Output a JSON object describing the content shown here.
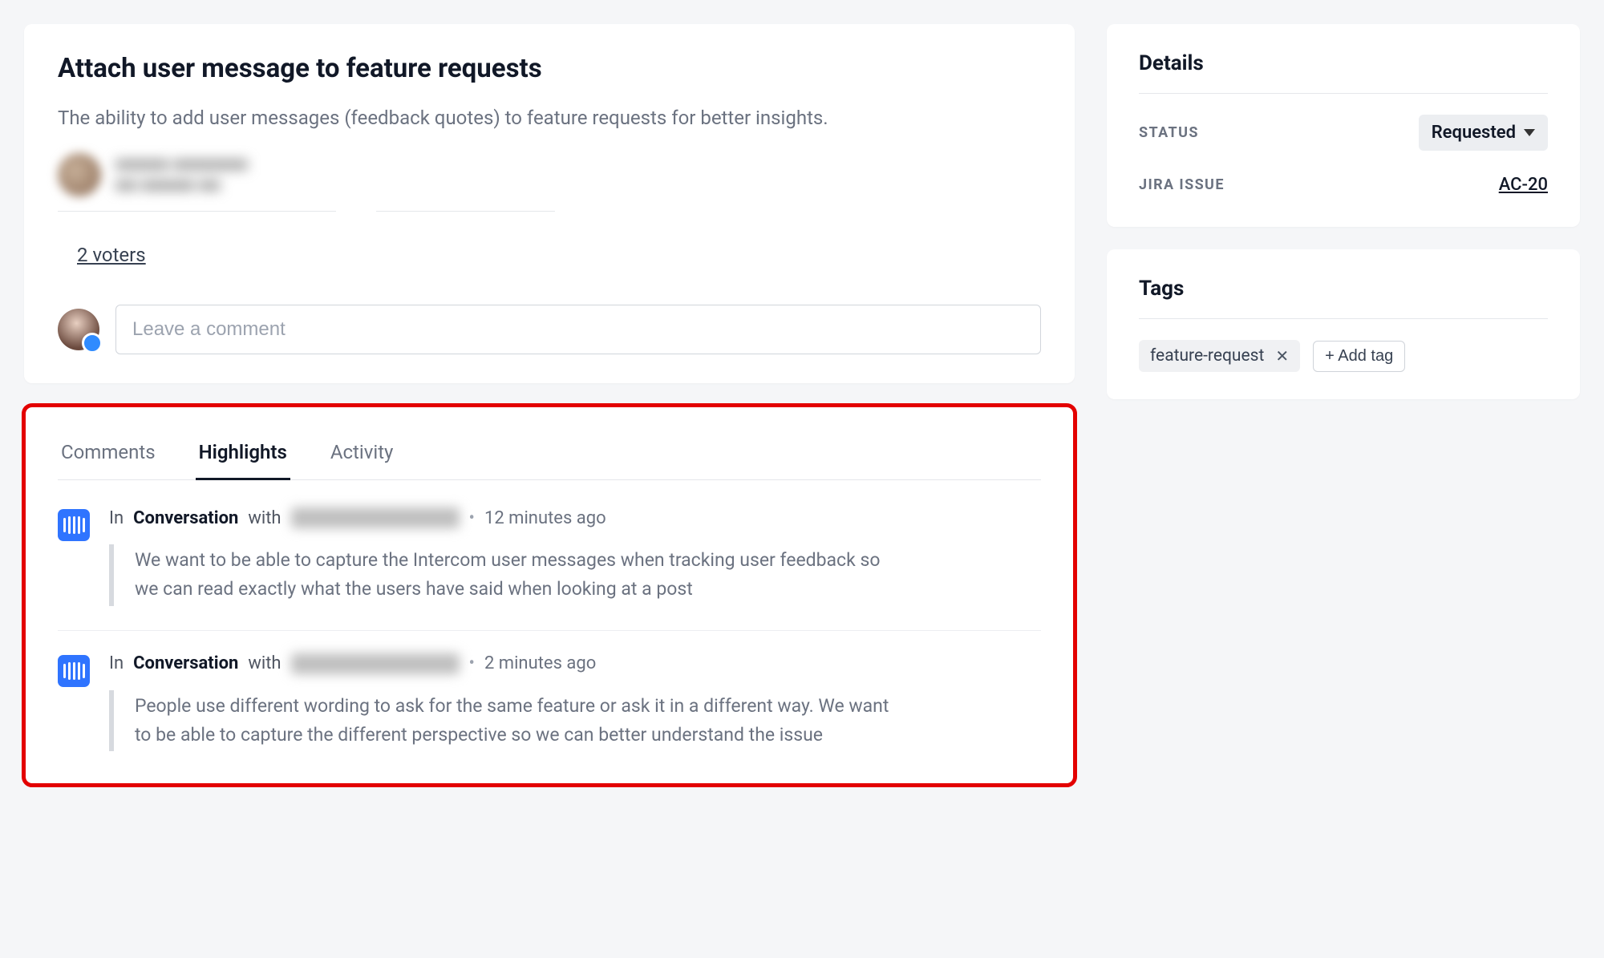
{
  "post": {
    "title": "Attach user message   to feature requests",
    "description": "The ability to add user messages (feedback quotes) to feature requests for better insights.",
    "voters_label": "2 voters",
    "comment_placeholder": "Leave a comment"
  },
  "tabs": {
    "comments": "Comments",
    "highlights": "Highlights",
    "activity": "Activity"
  },
  "highlights": [
    {
      "prefix": "In",
      "strong": "Conversation",
      "with": "with",
      "time": "12 minutes ago",
      "quote": "We want to be able to capture the Intercom user messages when tracking user feedback so we can read exactly what the users have said when looking at a post"
    },
    {
      "prefix": "In",
      "strong": "Conversation",
      "with": "with",
      "time": "2 minutes ago",
      "quote": "People use different wording to ask for the same feature or ask it in a different way. We want to be able to capture the different perspective so we can better understand the issue"
    }
  ],
  "details": {
    "title": "Details",
    "status_label": "STATUS",
    "status_value": "Requested",
    "jira_label": "JIRA ISSUE",
    "jira_value": "AC-20"
  },
  "tags": {
    "title": "Tags",
    "items": [
      "feature-request"
    ],
    "add_label": "+ Add tag"
  }
}
